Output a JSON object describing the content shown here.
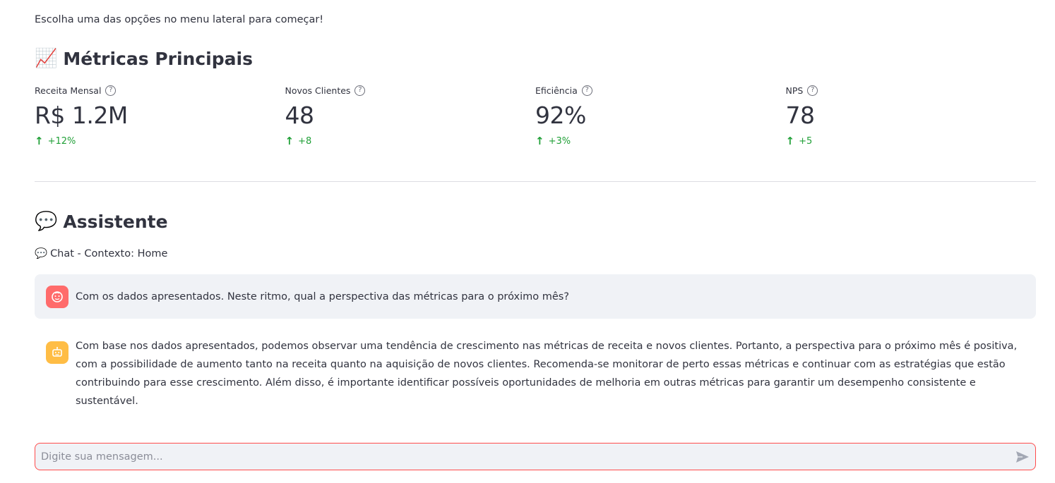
{
  "intro_text": "Escolha uma das opções no menu lateral para começar!",
  "metrics_section": {
    "emoji": "📈",
    "title": "Métricas Principais",
    "items": [
      {
        "label": "Receita Mensal",
        "value": "R$ 1.2M",
        "delta": "+12%"
      },
      {
        "label": "Novos Clientes",
        "value": "48",
        "delta": "+8"
      },
      {
        "label": "Eficiência",
        "value": "92%",
        "delta": "+3%"
      },
      {
        "label": "NPS",
        "value": "78",
        "delta": "+5"
      }
    ],
    "help_glyph": "?",
    "delta_arrow": "↑",
    "delta_color": "#21a038"
  },
  "assistant_section": {
    "emoji": "💬",
    "title": "Assistente",
    "caption_emoji": "💬",
    "caption": "Chat - Contexto: Home"
  },
  "messages": [
    {
      "role": "user",
      "text": "Com os dados apresentados. Neste ritmo, qual a perspectiva das métricas para o próximo mês?"
    },
    {
      "role": "assistant",
      "text": "Com base nos dados apresentados, podemos observar uma tendência de crescimento nas métricas de receita e novos clientes. Portanto, a perspectiva para o próximo mês é positiva, com a possibilidade de aumento tanto na receita quanto na aquisição de novos clientes. Recomenda-se monitorar de perto essas métricas e continuar com as estratégias que estão contribuindo para esse crescimento. Além disso, é importante identificar possíveis oportunidades de melhoria em outras métricas para garantir um desempenho consistente e sustentável."
    }
  ],
  "chat_input": {
    "placeholder": "Digite sua mensagem...",
    "value": ""
  },
  "colors": {
    "user_avatar": "#ff6b6b",
    "assistant_avatar": "#ffbd45",
    "input_border": "#ff4b4b"
  },
  "icons": {
    "user_avatar": "face-icon",
    "assistant_avatar": "robot-icon",
    "send": "send-icon",
    "help": "help-circle-icon"
  }
}
